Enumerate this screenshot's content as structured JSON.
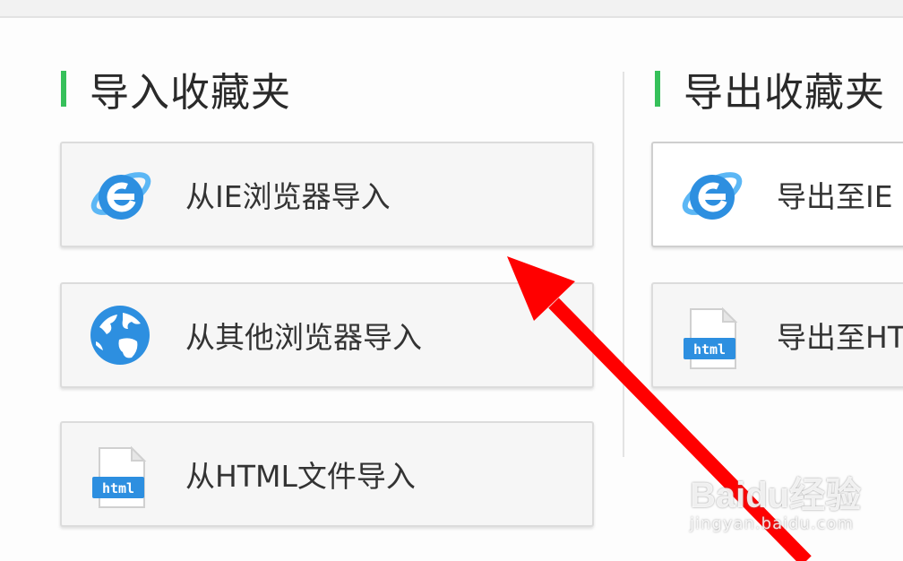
{
  "import_section": {
    "title": "导入收藏夹",
    "buttons": [
      {
        "label": "从IE浏览器导入",
        "icon": "ie-icon"
      },
      {
        "label": "从其他浏览器导入",
        "icon": "globe-icon"
      },
      {
        "label": "从HTML文件导入",
        "icon": "html-file-icon"
      }
    ]
  },
  "export_section": {
    "title": "导出收藏夹",
    "buttons": [
      {
        "label": "导出至IE",
        "icon": "ie-icon"
      },
      {
        "label": "导出至HT",
        "icon": "html-file-icon"
      }
    ]
  },
  "watermark": {
    "brand": "Baidu经验",
    "url": "jingyan.baidu.com"
  },
  "colors": {
    "accent_green": "#36c05a",
    "ie_blue": "#2d8fe0",
    "arrow_red": "#ff0000"
  }
}
